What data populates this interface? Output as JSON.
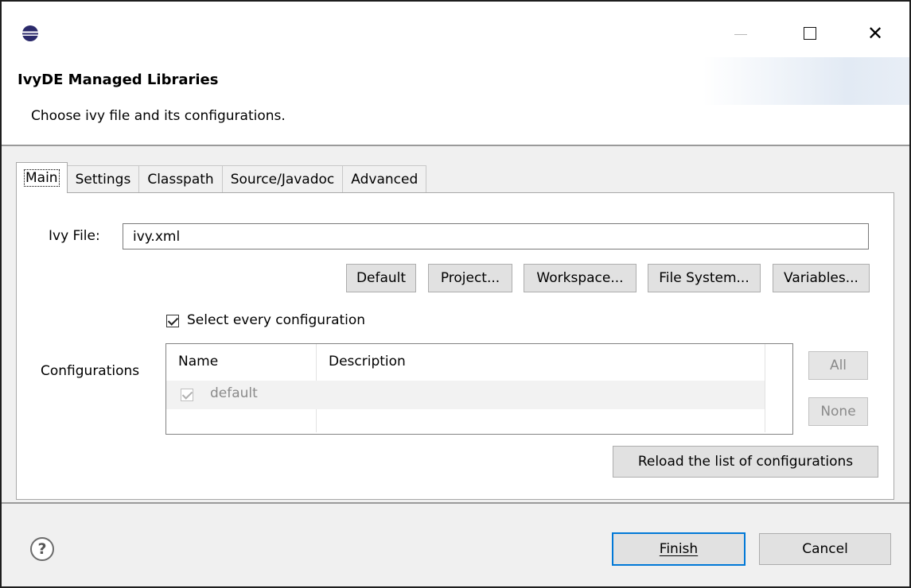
{
  "window": {
    "title": "",
    "icon": "eclipse-icon",
    "controls": {
      "minimize": "minimize-icon",
      "maximize": "maximize-icon",
      "close": "close-icon"
    }
  },
  "header": {
    "title": "IvyDE Managed Libraries",
    "description": "Choose ivy file and its configurations."
  },
  "tabs": [
    {
      "label": "Main",
      "active": true
    },
    {
      "label": "Settings",
      "active": false
    },
    {
      "label": "Classpath",
      "active": false
    },
    {
      "label": "Source/Javadoc",
      "active": false
    },
    {
      "label": "Advanced",
      "active": false
    }
  ],
  "main": {
    "ivy_file_label": "Ivy File:",
    "ivy_file_value": "ivy.xml",
    "buttons": {
      "default": "Default",
      "project": "Project...",
      "workspace": "Workspace...",
      "file_system": "File System...",
      "variables": "Variables..."
    },
    "select_every": {
      "label": "Select every configuration",
      "checked": true
    },
    "configurations_label": "Configurations",
    "table": {
      "columns": [
        "Name",
        "Description"
      ],
      "rows": [
        {
          "checked": true,
          "name": "default",
          "description": ""
        }
      ]
    },
    "all_button": "All",
    "none_button": "None",
    "reload_button": "Reload the list of configurations"
  },
  "footer": {
    "help_icon": "help-icon",
    "finish_button": "Finish",
    "cancel_button": "Cancel"
  },
  "colors": {
    "focus_border": "#0078d7",
    "panel_background": "#f0f0f0",
    "button_background": "#e1e1e1"
  }
}
